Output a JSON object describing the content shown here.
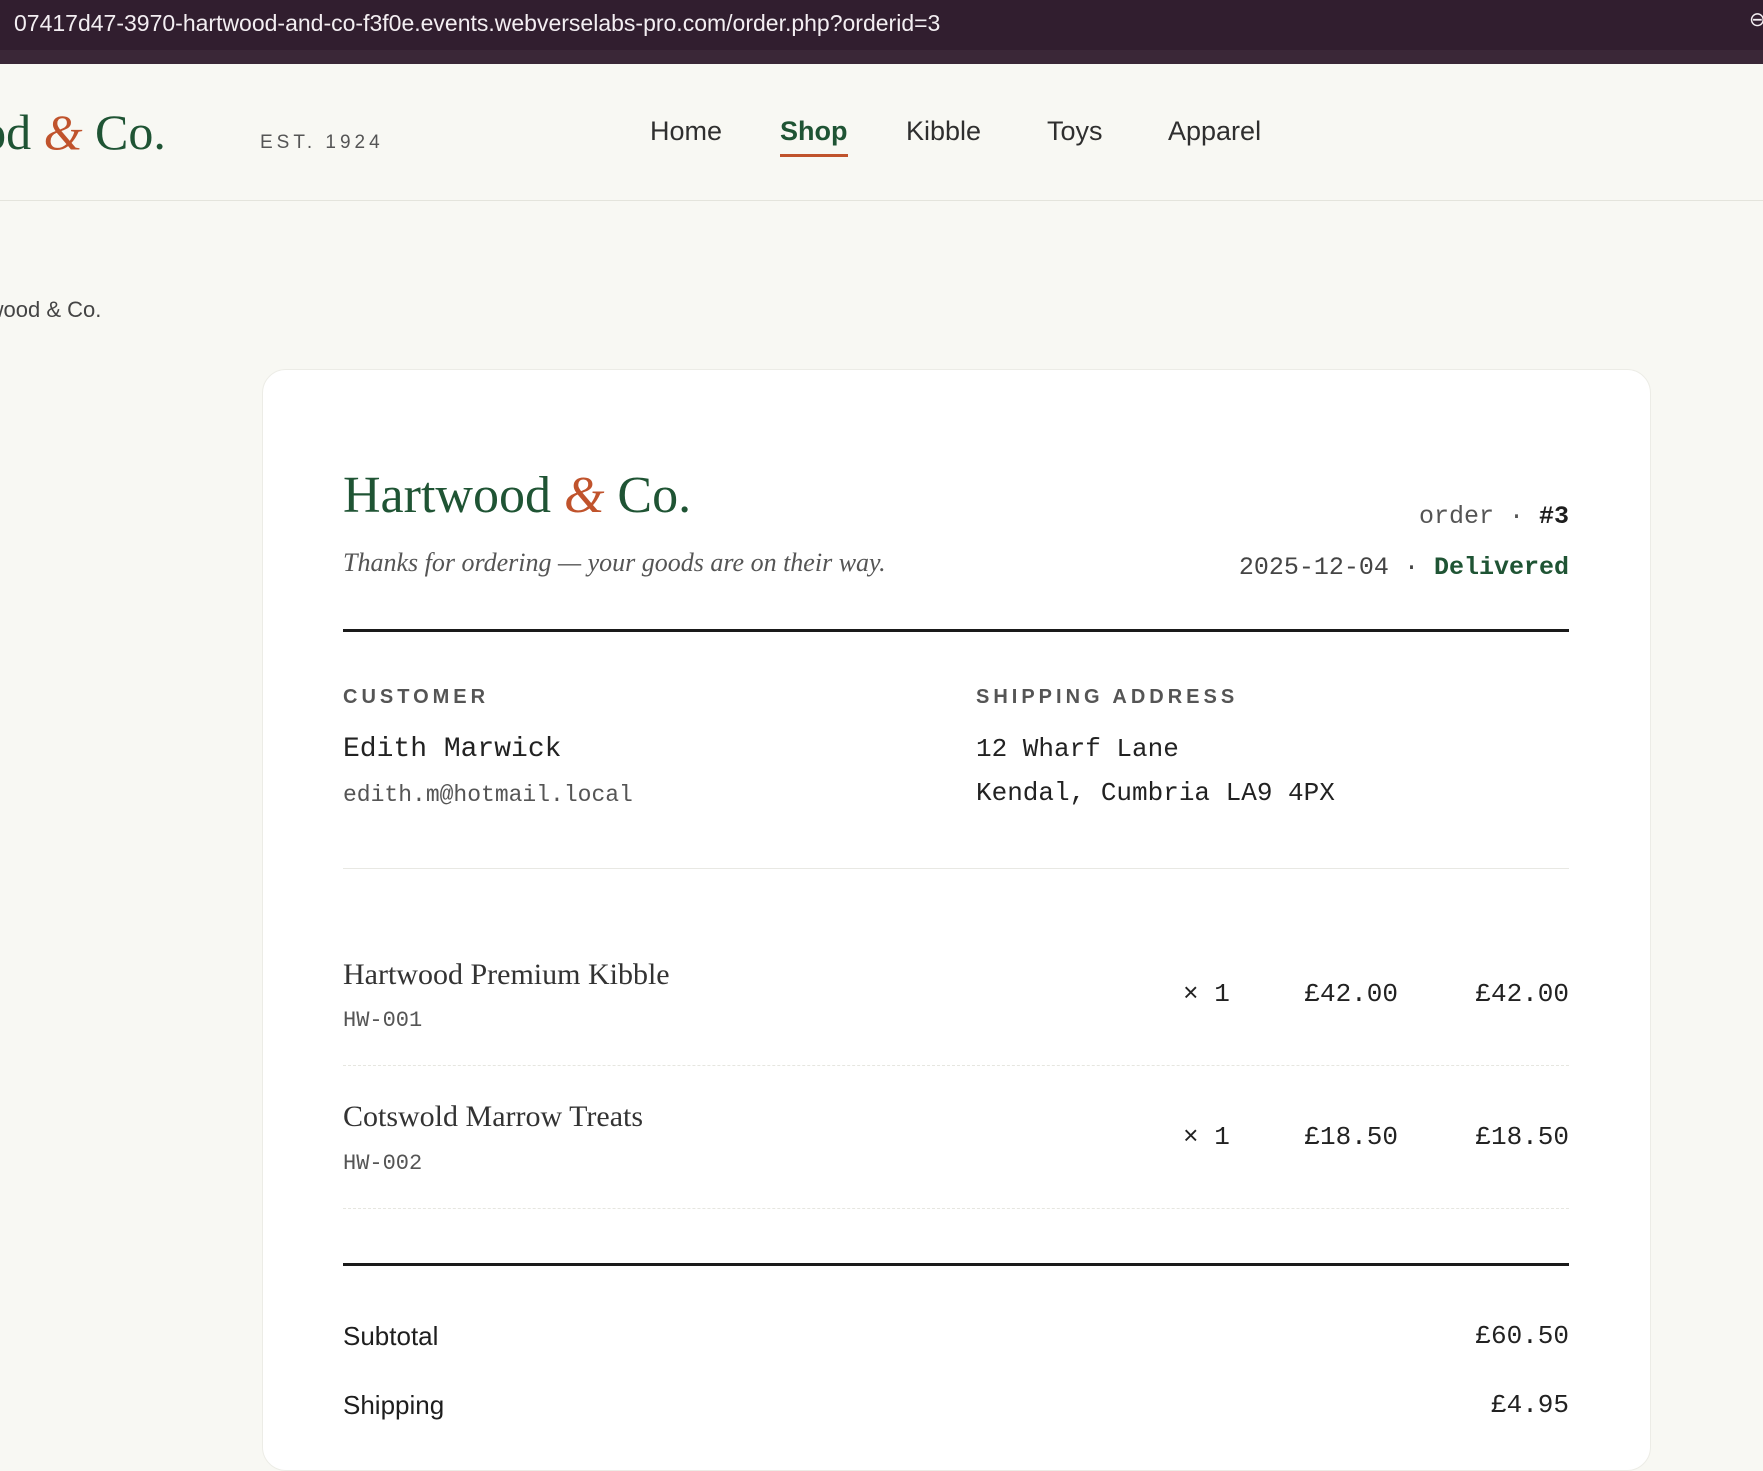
{
  "browser": {
    "url": "07417d47-3970-hartwood-and-co-f3f0e.events.webverselabs-pro.com/order.php?orderid=3"
  },
  "header": {
    "logo_text": "wood",
    "logo_amp": "&",
    "logo_co": "Co.",
    "established": "EST. 1924",
    "nav": [
      {
        "label": "Home",
        "active": false
      },
      {
        "label": "Shop",
        "active": true
      },
      {
        "label": "Kibble",
        "active": false
      },
      {
        "label": "Toys",
        "active": false
      },
      {
        "label": "Apparel",
        "active": false
      }
    ]
  },
  "breadcrumb": "artwood & Co.",
  "receipt": {
    "brand_name": "Hartwood",
    "brand_amp": "&",
    "brand_co": "Co.",
    "tagline": "Thanks for ordering — your goods are on their way.",
    "order_label": "order ·",
    "order_number": "#3",
    "date": "2025-12-04",
    "separator": "·",
    "status": "Delivered",
    "customer_label": "CUSTOMER",
    "customer_name": "Edith Marwick",
    "customer_email": "edith.m@hotmail.local",
    "shipping_label": "SHIPPING ADDRESS",
    "address_line1": "12 Wharf Lane",
    "address_line2": "Kendal, Cumbria LA9 4PX",
    "items": [
      {
        "name": "Hartwood Premium Kibble",
        "sku": "HW-001",
        "qty": "× 1",
        "unit_price": "£42.00",
        "line_total": "£42.00"
      },
      {
        "name": "Cotswold Marrow Treats",
        "sku": "HW-002",
        "qty": "× 1",
        "unit_price": "£18.50",
        "line_total": "£18.50"
      }
    ],
    "totals": [
      {
        "label": "Subtotal",
        "value": "£60.50"
      },
      {
        "label": "Shipping",
        "value": "£4.95"
      }
    ]
  },
  "colors": {
    "brand_green": "#1f5434",
    "accent_rust": "#c0532c",
    "browser_bar": "#311e2f"
  }
}
